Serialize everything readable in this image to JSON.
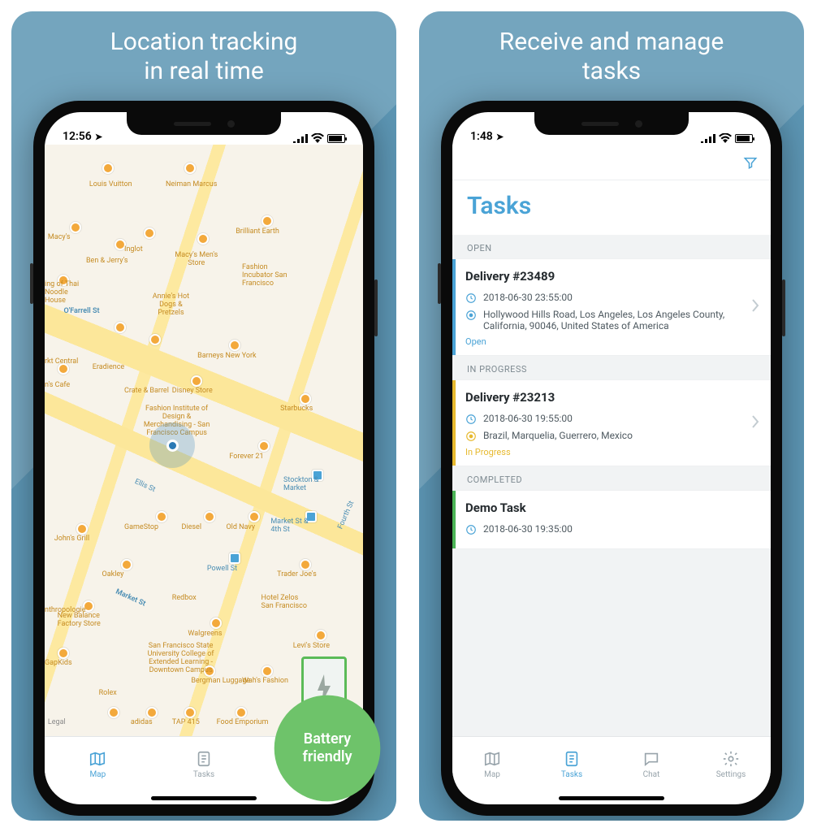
{
  "shots": {
    "left": {
      "title_l1": "Location tracking",
      "title_l2": "in real time"
    },
    "right": {
      "title_l1": "Receive and manage",
      "title_l2": "tasks"
    }
  },
  "badge": {
    "line1": "Battery",
    "line2": "friendly"
  },
  "colors": {
    "open": "#4aa3d6",
    "progress": "#e7b92e",
    "done": "#4bb456"
  },
  "status_left": {
    "time": "12:56"
  },
  "status_right": {
    "time": "1:48"
  },
  "tabs": {
    "map": "Map",
    "tasks": "Tasks",
    "chat": "Chat",
    "settings": "Settings"
  },
  "tasks_screen": {
    "title": "Tasks",
    "sections": {
      "open": "OPEN",
      "progress": "IN PROGRESS",
      "completed": "COMPLETED"
    },
    "open_task": {
      "title": "Delivery #23489",
      "time": "2018-06-30 23:55:00",
      "addr": "Hollywood Hills Road, Los Angeles, Los Angeles County, California, 90046, United States of America",
      "status": "Open"
    },
    "prog_task": {
      "title": "Delivery #23213",
      "time": "2018-06-30 19:55:00",
      "addr": "Brazil, Marquelia, Guerrero, Mexico",
      "status": "In Progress"
    },
    "done_task": {
      "title": "Demo Task",
      "time": "2018-06-30 19:35:00"
    }
  },
  "map_labels": {
    "l1": "Louis Vuitton",
    "l2": "Neiman Marcus",
    "l3": "Brilliant Earth",
    "l4": "Macy's",
    "l5": "Ben & Jerry's",
    "l6": "Macy's Men's Store",
    "l7": "Fashion Incubator San Francisco",
    "l8": "O'Farrell St",
    "l9": "ing of Thai Noodle House",
    "l10": "Annie's Hot Dogs & Pretzels",
    "l11": "Barneys New York",
    "l12": "Inglot",
    "l13": "Disney Store",
    "l14": "Crate & Barrel",
    "l15": "Starbucks",
    "l16": "Fashion Institute of Design & Merchandising - San Francisco Campus",
    "l17": "Forever 21",
    "l18": "Stockton & Market",
    "l19": "Ellis St",
    "l20": "Market St & 4th St",
    "l21": "John's Grill",
    "l22": "GameStop",
    "l23": "Diesel",
    "l24": "Old Navy",
    "l25": "Powell St",
    "l26": "Oakley",
    "l27": "Trader Joe's",
    "l28": "Market St",
    "l29": "New Balance Factory Store",
    "l30": "Walgreens",
    "l31": "Hotel Zelos San Francisco",
    "l32": "Levi's Store",
    "l33": "GapKids",
    "l34": "San Francisco State University College of Extended Learning - Downtown Campus",
    "l35": "Rolex",
    "l36": "adidas",
    "l37": "TAP 415",
    "l38": "Food Emporium",
    "l39": "Bergman Luggage",
    "l40": "Wah's Fashion",
    "l41": "Fourth St",
    "l42": "Redbox",
    "l43": "Eradience",
    "l44": "rkt Central",
    "l45": "n's Cafe",
    "l46": "nthropologie",
    "l47": "Legal"
  }
}
